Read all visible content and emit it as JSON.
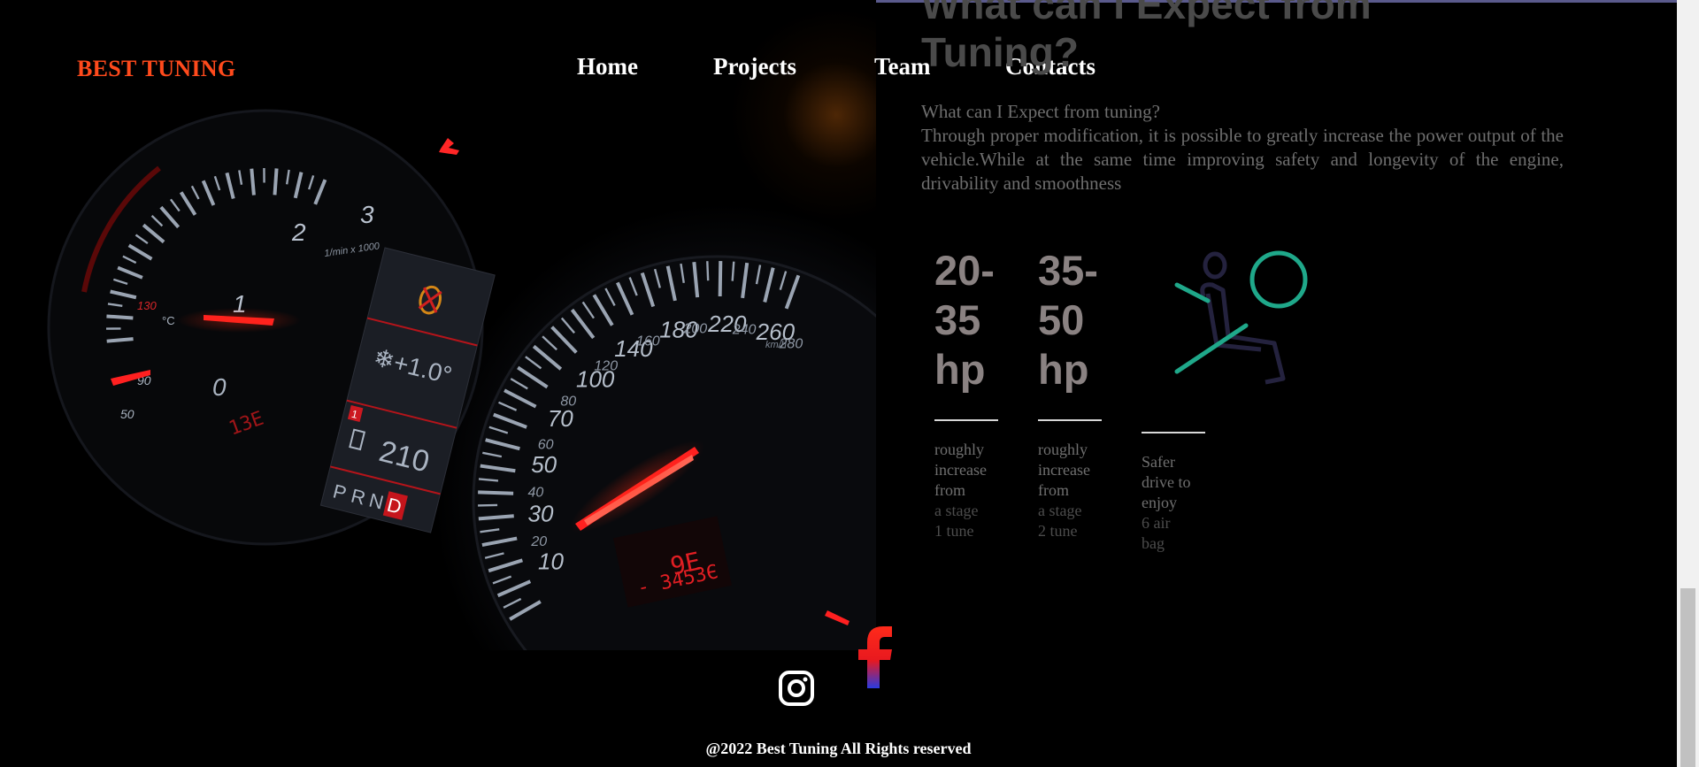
{
  "brand": {
    "logo": "BEST TUNING"
  },
  "nav": [
    "Home",
    "Projects",
    "Team",
    "Contacts"
  ],
  "section": {
    "heading_line1": "What can I Expect from",
    "heading_line2": "Tuning?",
    "intro_title": "What can I Expect from tuning?",
    "intro_body": "Through proper modification, it is possible to greatly increase the power output of the vehicle.While at the same time improving safety and longevity of the engine, drivability and smoothness"
  },
  "stats": [
    {
      "lines": [
        "20-",
        "35",
        "hp"
      ],
      "desc": [
        "roughly",
        "increase",
        "from",
        "a stage",
        "1 tune"
      ]
    },
    {
      "lines": [
        "35-",
        "50",
        "hp"
      ],
      "desc": [
        "roughly",
        "increase",
        "from",
        "a stage",
        "2 tune"
      ]
    }
  ],
  "safety": {
    "icon": "airbag-icon",
    "desc": [
      "Safer",
      "drive to",
      "enjoy",
      "6 air",
      "bag"
    ]
  },
  "social": [
    "instagram-icon",
    "facebook-icon"
  ],
  "footer": {
    "copyright": "@2022 Best Tuning All Rights reserved"
  },
  "dashboard": {
    "tach_labels": [
      "0",
      "1",
      "2",
      "3"
    ],
    "tach_unit": "1/min x 1000",
    "speed_labels": [
      "10",
      "20",
      "30",
      "40",
      "50",
      "60",
      "70",
      "80",
      "100",
      "120",
      "140",
      "160",
      "180",
      "200",
      "220",
      "240",
      "260",
      "280"
    ],
    "speed_unit": "km/h",
    "temp_labels": [
      "130",
      "90",
      "50"
    ],
    "temp_unit": "°C",
    "outside_temp": "❄+1.0°",
    "range": "210",
    "gear_marker": "1",
    "gears": [
      "P",
      "R",
      "N",
      "D"
    ],
    "odometer_top": "9E",
    "odometer": "- 3453Є",
    "trip": "13E"
  },
  "colors": {
    "logo": "#ff4a1c",
    "stat": "#8a8282",
    "airbag_accent": "#1fa88a",
    "airbag_body": "#24223e",
    "needle": "#ff2020",
    "facebook_top": "#ff2a1a",
    "facebook_bottom": "#2b3be0"
  }
}
